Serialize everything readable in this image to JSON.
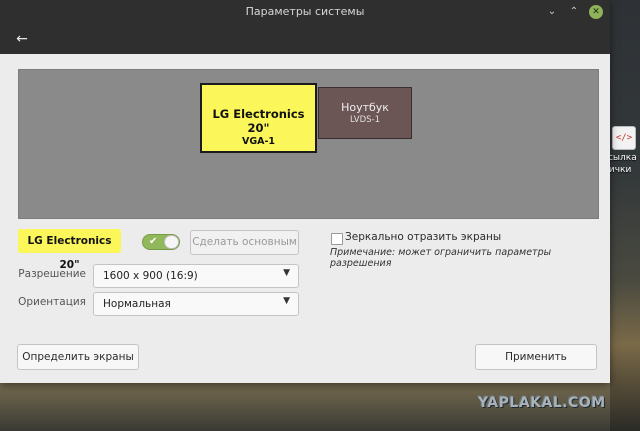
{
  "window": {
    "title": "Параметры системы"
  },
  "header": {
    "back_icon": "back-arrow-icon"
  },
  "displays": {
    "primary": {
      "name": "LG Electronics 20\"",
      "port": "VGA-1",
      "color": "#fbf75a"
    },
    "laptop": {
      "name": "Ноутбук",
      "port": "LVDS-1",
      "color": "#6b5555"
    }
  },
  "settings": {
    "selected_monitor": "LG Electronics 20\"",
    "enabled": true,
    "make_primary_label": "Сделать основным",
    "mirror_label": "Зеркально отразить экраны",
    "mirror_checked": false,
    "note": "Примечание: может ограничить параметры разрешения",
    "resolution_label": "Разрешение",
    "resolution_value": "1600 x 900 (16:9)",
    "orientation_label": "Ориентация",
    "orientation_value": "Нормальная"
  },
  "footer": {
    "detect_label": "Определить экраны",
    "apply_label": "Применить"
  },
  "desktop": {
    "icon_label": "ссылка на\nпички",
    "watermark": "YAPLAKAL.COM"
  },
  "colors": {
    "accent_toggle": "#92b85c",
    "titlebar": "#2f2f2f"
  }
}
